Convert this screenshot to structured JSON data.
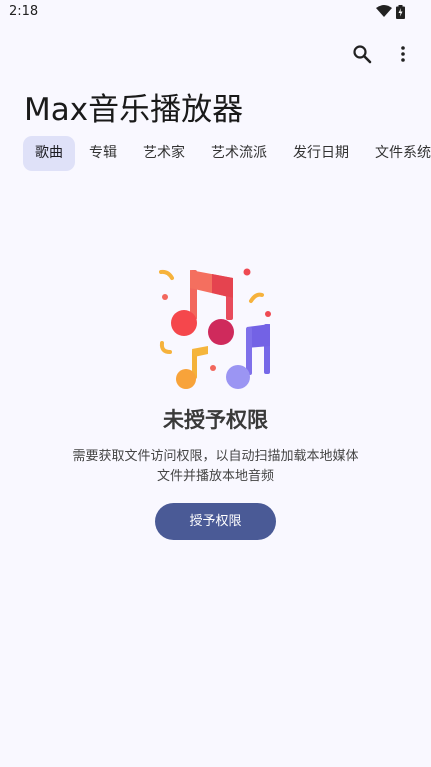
{
  "status_bar": {
    "time": "2:18",
    "wifi_icon": "wifi-icon",
    "battery_icon": "battery-icon"
  },
  "toolbar": {
    "search_icon": "search-icon",
    "more_icon": "more-vert-icon"
  },
  "app": {
    "title": "Max音乐播放器"
  },
  "tabs": [
    {
      "label": "歌曲",
      "active": true
    },
    {
      "label": "专辑",
      "active": false
    },
    {
      "label": "艺术家",
      "active": false
    },
    {
      "label": "艺术流派",
      "active": false
    },
    {
      "label": "发行日期",
      "active": false
    },
    {
      "label": "文件系统",
      "active": false
    }
  ],
  "empty_state": {
    "illustration_icon": "music-notes-icon",
    "title": "未授予权限",
    "description_line1": "需要获取文件访问权限，以自动扫描加载本地媒体",
    "description_line2": "文件并播放本地音频",
    "button_label": "授予权限"
  },
  "colors": {
    "background": "#f9f8ff",
    "tab_active_bg": "#dfe1f8",
    "button_bg": "#4a5a96"
  }
}
